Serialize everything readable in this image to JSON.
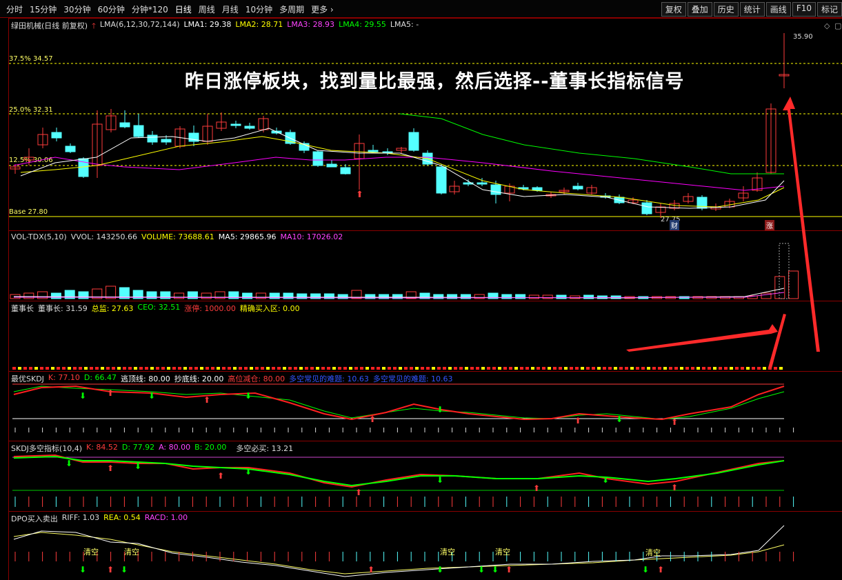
{
  "toolbar": {
    "items": [
      "分时",
      "15分钟",
      "30分钟",
      "60分钟",
      "分钟*120",
      "日线",
      "周线",
      "月线",
      "10分钟",
      "多周期",
      "更多 ›"
    ],
    "active": "日线",
    "right_buttons": [
      "复权",
      "叠加",
      "历史",
      "统计",
      "画线",
      "F10",
      "标记"
    ]
  },
  "main": {
    "title": "绿田机械(日线 前复权)",
    "indicator": "LMA(6,12,30,72,144)",
    "lma1": "LMA1: 29.38",
    "lma2": "LMA2: 28.71",
    "lma3": "LMA3: 28.93",
    "lma4": "LMA4: 29.55",
    "lma5": "LMA5: -",
    "levels": [
      "37.5% 34.57",
      "25.0% 32.31",
      "12.5% 30.06",
      "Base 27.80"
    ],
    "high_label": "35.90",
    "low_label": "27.75",
    "badge_cai": "财",
    "badge_zhang": "涨",
    "annotation": "昨日涨停板块，找到量比最强，然后选择--董事长指标信号"
  },
  "vol": {
    "name": "VOL-TDX(5,10)",
    "vvol": "VVOL: 143250.66",
    "volume": "VOLUME: 73688.61",
    "ma5": "MA5: 29865.96",
    "ma10": "MA10: 17026.02"
  },
  "dsz": {
    "name": "董事长",
    "a": "董事长: 31.59",
    "b": "总监: 27.63",
    "c": "CEO: 32.51",
    "d": "涨停: 1000.00",
    "e": "精确买入区: 0.00"
  },
  "skdj1": {
    "name": "最优SKDJ",
    "k": "K: 77.10",
    "d": "D: 66.47",
    "top": "逃顶线: 80.00",
    "bottom": "抄底线: 20.00",
    "high": "高位减仓: 80.00",
    "e1": "多空常见的难题: 10.63",
    "e2": "多空常见的难题: 10.63"
  },
  "skdj2": {
    "name": "SKDJ多空指标(10,4)",
    "k": "K: 84.52",
    "d": "D: 77.92",
    "a": "A: 80.00",
    "b": "B: 20.00",
    "buy": "多空必买: 13.21"
  },
  "dpo": {
    "name": "DPO买入卖出",
    "riff": "RIFF: 1.03",
    "rea": "REA: 0.54",
    "racd": "RACD: 1.00",
    "clear_label": "清空"
  },
  "colors": {
    "up": "#ff3c3c",
    "down": "#54ffff",
    "lma1": "#ffffff",
    "lma2": "#ffff00",
    "lma3": "#ff00ff",
    "lma4": "#00ff00",
    "grid": "#8b0000"
  }
}
